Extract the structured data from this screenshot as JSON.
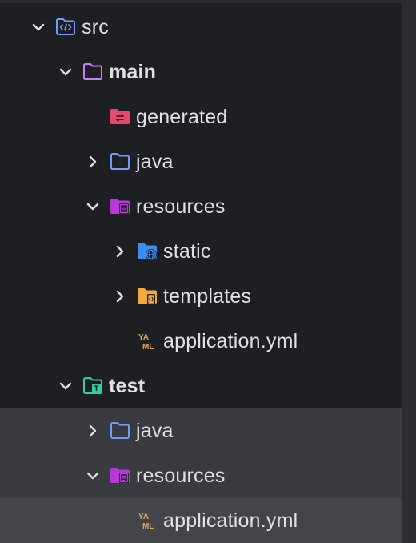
{
  "tree": {
    "nodes": [
      {
        "label": "src",
        "bold": false,
        "indent": 0,
        "chevron": "down",
        "icon": "source-folder-icon",
        "state": "normal"
      },
      {
        "label": "main",
        "bold": true,
        "indent": 1,
        "chevron": "down",
        "icon": "module-folder-icon",
        "state": "normal"
      },
      {
        "label": "generated",
        "bold": false,
        "indent": 2,
        "chevron": "none",
        "icon": "generated-folder-icon",
        "state": "normal"
      },
      {
        "label": "java",
        "bold": false,
        "indent": 2,
        "chevron": "right",
        "icon": "folder-icon",
        "state": "normal"
      },
      {
        "label": "resources",
        "bold": false,
        "indent": 2,
        "chevron": "down",
        "icon": "resources-folder-icon",
        "state": "normal"
      },
      {
        "label": "static",
        "bold": false,
        "indent": 3,
        "chevron": "right",
        "icon": "web-folder-icon",
        "state": "normal"
      },
      {
        "label": "templates",
        "bold": false,
        "indent": 3,
        "chevron": "right",
        "icon": "templates-folder-icon",
        "state": "normal"
      },
      {
        "label": "application.yml",
        "bold": false,
        "indent": 3,
        "chevron": "none",
        "icon": "yaml-file-icon",
        "state": "normal"
      },
      {
        "label": "test",
        "bold": true,
        "indent": 1,
        "chevron": "down",
        "icon": "test-folder-icon",
        "state": "normal"
      },
      {
        "label": "java",
        "bold": false,
        "indent": 2,
        "chevron": "right",
        "icon": "folder-icon",
        "state": "inactive-selection"
      },
      {
        "label": "resources",
        "bold": false,
        "indent": 2,
        "chevron": "down",
        "icon": "resources-folder-icon",
        "state": "inactive-selection"
      },
      {
        "label": "application.yml",
        "bold": false,
        "indent": 3,
        "chevron": "none",
        "icon": "yaml-file-icon",
        "state": "selected"
      }
    ]
  },
  "colors": {
    "background": "#1e1f22",
    "text": "#dfe1e5",
    "chevron": "#dfe1e5",
    "selection_inactive": "#393b40",
    "selection": "#43454a",
    "folder_blue": "#6e9ef9",
    "folder_purple": "#c77dff",
    "generated_red": "#e8486e",
    "resources_purple": "#b63ad6",
    "web_blue": "#3a8ff0",
    "template_orange": "#f2a93b",
    "test_green": "#2fcf9e",
    "yaml_orange": "#e3a25a"
  }
}
